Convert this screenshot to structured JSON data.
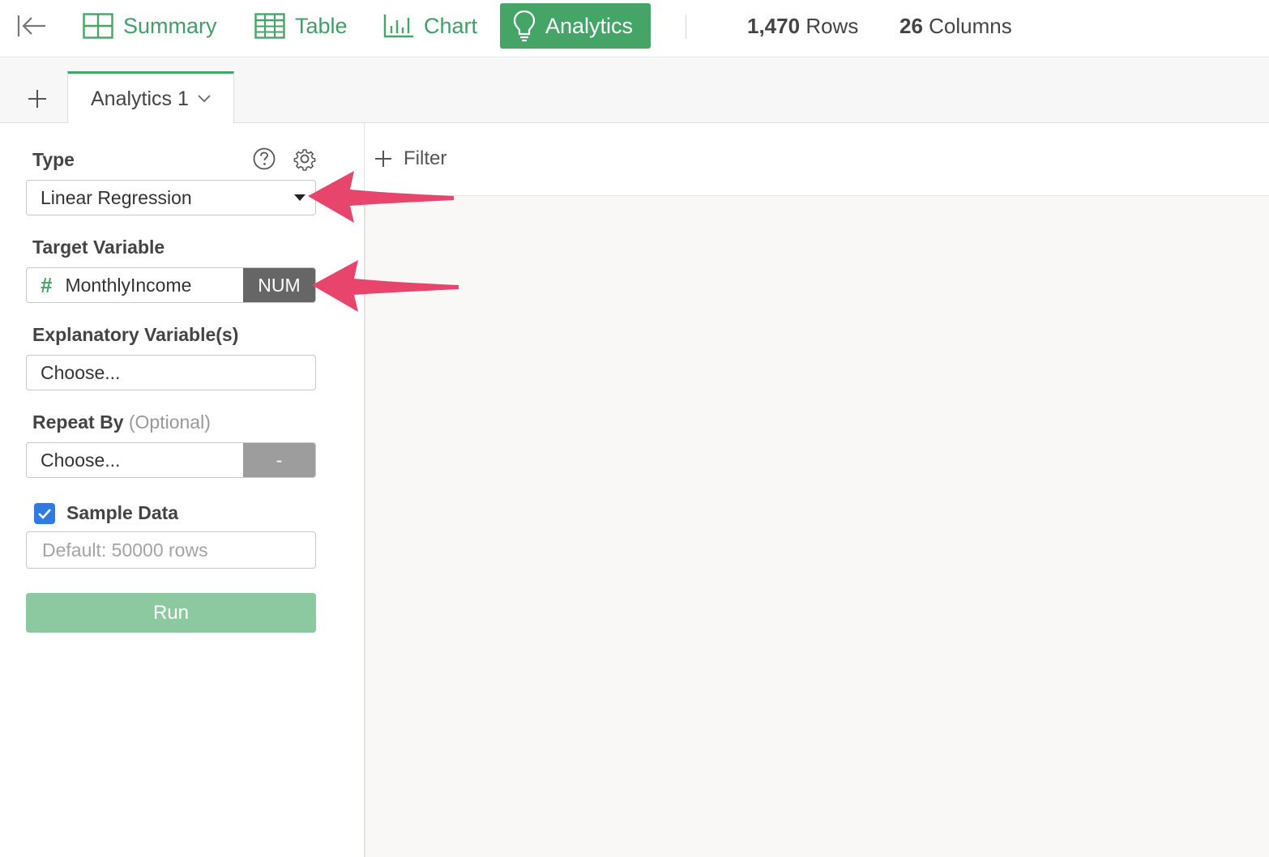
{
  "toolbar": {
    "tabs": [
      {
        "label": "Summary",
        "icon": "summary-grid-icon",
        "active": false
      },
      {
        "label": "Table",
        "icon": "table-icon",
        "active": false
      },
      {
        "label": "Chart",
        "icon": "bar-chart-icon",
        "active": false
      },
      {
        "label": "Analytics",
        "icon": "lightbulb-icon",
        "active": true
      }
    ],
    "rows_count": "1,470",
    "rows_label": "Rows",
    "columns_count": "26",
    "columns_label": "Columns"
  },
  "sheet_tabs": {
    "add_icon": "plus-icon",
    "active_tab": "Analytics 1"
  },
  "panel": {
    "type_label": "Type",
    "type_value": "Linear Regression",
    "target_label": "Target Variable",
    "target_value": "MonthlyIncome",
    "target_type_icon": "#",
    "target_badge": "NUM",
    "explanatory_label": "Explanatory Variable(s)",
    "explanatory_value": "Choose...",
    "repeat_label": "Repeat By",
    "repeat_optional": "(Optional)",
    "repeat_value": "Choose...",
    "repeat_badge": "-",
    "sample_label": "Sample Data",
    "sample_checked": true,
    "sample_placeholder": "Default: 50000 rows",
    "run_label": "Run"
  },
  "filter": {
    "label": "Filter"
  },
  "colors": {
    "accent_green": "#44a567",
    "run_button": "#8cc8a0",
    "annotation_arrow": "#e8456d",
    "num_badge": "#666666",
    "checkbox": "#2f7ae5"
  }
}
